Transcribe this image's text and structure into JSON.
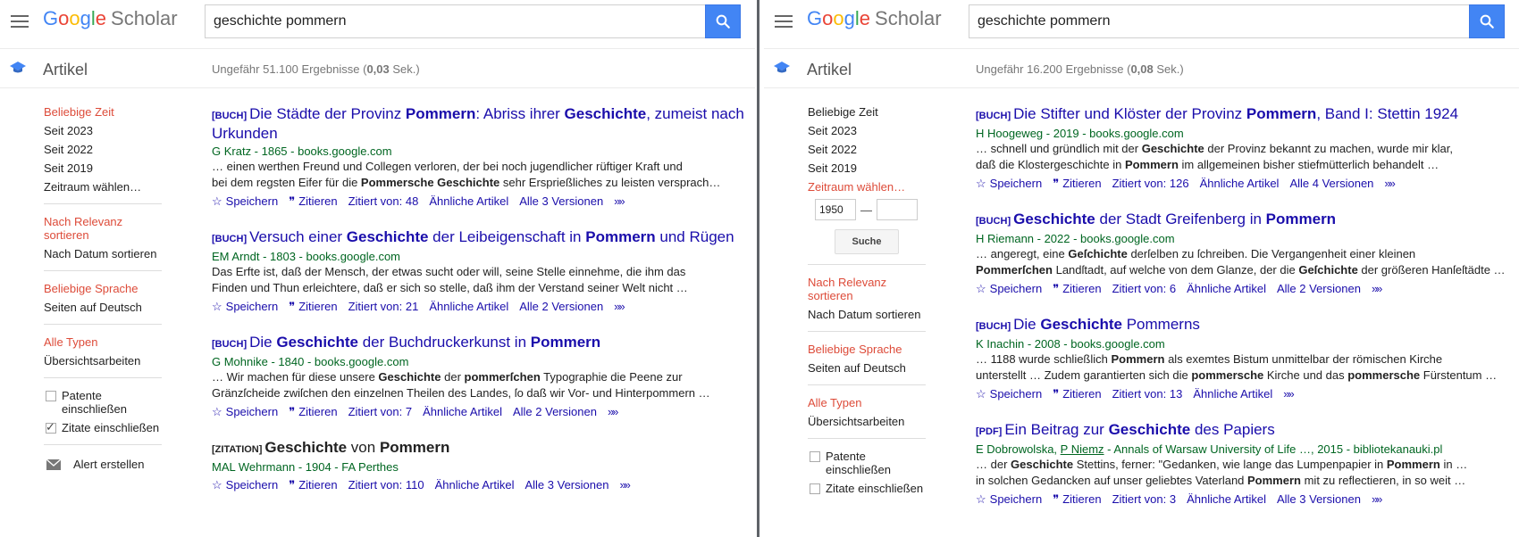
{
  "logo": {
    "google": [
      "G",
      "o",
      "o",
      "g",
      "l",
      "e"
    ],
    "scholar": "Scholar"
  },
  "section_title": "Artikel",
  "panels": [
    {
      "query": "geschichte pommern",
      "stats": {
        "prefix": "Ungefähr 51.100 Ergebnisse (",
        "time": "0,03",
        "suffix": " Sek.)"
      },
      "sidebar": {
        "time": [
          "Beliebige Zeit",
          "Seit 2023",
          "Seit 2022",
          "Seit 2019",
          "Zeitraum wählen…"
        ],
        "sort": [
          "Nach Relevanz sortieren",
          "Nach Datum sortieren"
        ],
        "lang": [
          "Beliebige Sprache",
          "Seiten auf Deutsch"
        ],
        "types": [
          "Alle Typen",
          "Übersichtsarbeiten"
        ],
        "checks": [
          {
            "label": "Patente einschließen",
            "checked": false
          },
          {
            "label": "Zitate einschließen",
            "checked": true
          }
        ],
        "alert": "Alert erstellen"
      },
      "results": [
        {
          "tag": "[BUCH]",
          "title": [
            [
              "Die Städte der Provinz ",
              false
            ],
            [
              "Pommern",
              true
            ],
            [
              ": Abriss ihrer ",
              false
            ],
            [
              "Geschichte",
              true
            ],
            [
              ", zumeist nach Urkunden",
              false
            ]
          ],
          "authors": [
            [
              "G Kratz - 1865 - books.google.com",
              false
            ]
          ],
          "snippet": [
            [
              [
                "… einen werthen Freund und Collegen verloren, der bei noch jugendlicher rüftiger Kraft und",
                false
              ]
            ],
            [
              [
                "bei dem regsten Eifer für die ",
                false
              ],
              [
                "Pommersche Geschichte",
                true
              ],
              [
                " sehr Ersprießliches zu leisten versprach…",
                false
              ]
            ]
          ],
          "links": {
            "save": "Speichern",
            "cite": "Zitieren",
            "cited": "Zitiert von: 48",
            "related": "Ähnliche Artikel",
            "versions": "Alle 3 Versionen"
          }
        },
        {
          "tag": "[BUCH]",
          "title": [
            [
              "Versuch einer ",
              false
            ],
            [
              "Geschichte",
              true
            ],
            [
              " der Leibeigenschaft in ",
              false
            ],
            [
              "Pommern",
              true
            ],
            [
              " und Rügen",
              false
            ]
          ],
          "authors": [
            [
              "EM Arndt - 1803 - books.google.com",
              false
            ]
          ],
          "snippet": [
            [
              [
                "Das Erfte ist, daß der Mensch, der etwas sucht oder will, seine Stelle einnehme, die ihm das",
                false
              ]
            ],
            [
              [
                "Finden und Thun erleichtere, daß er sich so stelle, daß ihm der Verstand seiner Welt nicht …",
                false
              ]
            ]
          ],
          "links": {
            "save": "Speichern",
            "cite": "Zitieren",
            "cited": "Zitiert von: 21",
            "related": "Ähnliche Artikel",
            "versions": "Alle 2 Versionen"
          }
        },
        {
          "tag": "[BUCH]",
          "title": [
            [
              "Die ",
              false
            ],
            [
              "Geschichte",
              true
            ],
            [
              " der Buchdruckerkunst in ",
              false
            ],
            [
              "Pommern",
              true
            ]
          ],
          "authors": [
            [
              "G Mohnike - 1840 - books.google.com",
              false
            ]
          ],
          "snippet": [
            [
              [
                "… Wir machen für diese unsere ",
                false
              ],
              [
                "Geschichte",
                true
              ],
              [
                " der ",
                false
              ],
              [
                "pommerſchen",
                true
              ],
              [
                " Typographie die Peene zur",
                false
              ]
            ],
            [
              [
                "Gränzſcheide zwiſchen den einzelnen Theilen des Landes, ſo daß wir Vor- und Hinterpommern …",
                false
              ]
            ]
          ],
          "links": {
            "save": "Speichern",
            "cite": "Zitieren",
            "cited": "Zitiert von: 7",
            "related": "Ähnliche Artikel",
            "versions": "Alle 2 Versionen"
          }
        },
        {
          "tag": "[ZITATION]",
          "plain": true,
          "title": [
            [
              "Geschichte",
              true
            ],
            [
              " von ",
              false
            ],
            [
              "Pommern",
              true
            ]
          ],
          "authors": [
            [
              "MAL Wehrmann - 1904 - FA Perthes",
              false
            ]
          ],
          "snippet": [],
          "links": {
            "save": "Speichern",
            "cite": "Zitieren",
            "cited": "Zitiert von: 110",
            "related": "Ähnliche Artikel",
            "versions": "Alle 3 Versionen"
          }
        }
      ]
    },
    {
      "query": "geschichte pommern",
      "stats": {
        "prefix": "Ungefähr 16.200 Ergebnisse (",
        "time": "0,08",
        "suffix": " Sek.)"
      },
      "sidebar": {
        "time": [
          "Beliebige Zeit",
          "Seit 2023",
          "Seit 2022",
          "Seit 2019",
          "Zeitraum wählen…"
        ],
        "range": {
          "from": "1950",
          "to": "",
          "button": "Suche"
        },
        "sort": [
          "Nach Relevanz sortieren",
          "Nach Datum sortieren"
        ],
        "lang": [
          "Beliebige Sprache",
          "Seiten auf Deutsch"
        ],
        "types": [
          "Alle Typen",
          "Übersichtsarbeiten"
        ],
        "checks": [
          {
            "label": "Patente einschließen",
            "checked": false
          },
          {
            "label": "Zitate einschließen",
            "checked": false
          }
        ]
      },
      "results": [
        {
          "tag": "[BUCH]",
          "title": [
            [
              "Die Stifter und Klöster der Provinz ",
              false
            ],
            [
              "Pommern",
              true
            ],
            [
              ", Band I: Stettin 1924",
              false
            ]
          ],
          "authors": [
            [
              "H Hoogeweg - 2019 - books.google.com",
              false
            ]
          ],
          "snippet": [
            [
              [
                "… schnell und gründlich mit der ",
                false
              ],
              [
                "Geschichte",
                true
              ],
              [
                " der Provinz bekannt zu machen, wurde mir klar,",
                false
              ]
            ],
            [
              [
                "daß die Klostergeschichte in ",
                false
              ],
              [
                "Pommern",
                true
              ],
              [
                " im allgemeinen bisher stiefmütterlich behandelt …",
                false
              ]
            ]
          ],
          "links": {
            "save": "Speichern",
            "cite": "Zitieren",
            "cited": "Zitiert von: 126",
            "related": "Ähnliche Artikel",
            "versions": "Alle 4 Versionen"
          }
        },
        {
          "tag": "[BUCH]",
          "title": [
            [
              "Geschichte",
              true
            ],
            [
              " der Stadt Greifenberg in ",
              false
            ],
            [
              "Pommern",
              true
            ]
          ],
          "authors": [
            [
              "H Riemann - 2022 - books.google.com",
              false
            ]
          ],
          "snippet": [
            [
              [
                "… angeregt, eine ",
                false
              ],
              [
                "Geſchichte",
                true
              ],
              [
                " derſelben zu ſchreiben. Die Vergangenheit einer kleinen",
                false
              ]
            ],
            [
              [
                "Pommerſchen",
                true
              ],
              [
                " Landſtadt, auf welche von dem Glanze, der die ",
                false
              ],
              [
                "Geſchichte",
                true
              ],
              [
                " der größeren Hanſeſtädte …",
                false
              ]
            ]
          ],
          "links": {
            "save": "Speichern",
            "cite": "Zitieren",
            "cited": "Zitiert von: 6",
            "related": "Ähnliche Artikel",
            "versions": "Alle 2 Versionen"
          }
        },
        {
          "tag": "[BUCH]",
          "title": [
            [
              "Die ",
              false
            ],
            [
              "Geschichte",
              true
            ],
            [
              " Pommerns",
              false
            ]
          ],
          "authors": [
            [
              "K Inachin - 2008 - books.google.com",
              false
            ]
          ],
          "snippet": [
            [
              [
                "… 1188 wurde schließlich ",
                false
              ],
              [
                "Pommern",
                true
              ],
              [
                " als exemtes Bistum unmittelbar der römischen Kirche",
                false
              ]
            ],
            [
              [
                "unterstellt … Zudem garantierten sich die ",
                false
              ],
              [
                "pommersche",
                true
              ],
              [
                " Kirche und das ",
                false
              ],
              [
                "pommersche",
                true
              ],
              [
                " Fürstentum …",
                false
              ]
            ]
          ],
          "links": {
            "save": "Speichern",
            "cite": "Zitieren",
            "cited": "Zitiert von: 13",
            "related": "Ähnliche Artikel"
          }
        },
        {
          "tag": "[PDF]",
          "title": [
            [
              "Ein Beitrag zur ",
              false
            ],
            [
              "Geschichte",
              true
            ],
            [
              " des Papiers",
              false
            ]
          ],
          "authors": [
            [
              "E Dobrowolska, ",
              false
            ],
            [
              "P Niemz",
              "u"
            ],
            [
              " - Annals of Warsaw University of Life …, 2015 - bibliotekanauki.pl",
              false
            ]
          ],
          "snippet": [
            [
              [
                "… der ",
                false
              ],
              [
                "Geschichte",
                true
              ],
              [
                " Stettins, ferner: \"Gedanken, wie lange das Lumpenpapier in ",
                false
              ],
              [
                "Pommern",
                true
              ],
              [
                " in …",
                false
              ]
            ],
            [
              [
                "in solchen Gedancken auf unser geliebtes Vaterland ",
                false
              ],
              [
                "Pommern",
                true
              ],
              [
                " mit zu reflectieren, in so weit …",
                false
              ]
            ]
          ],
          "links": {
            "save": "Speichern",
            "cite": "Zitieren",
            "cited": "Zitiert von: 3",
            "related": "Ähnliche Artikel",
            "versions": "Alle 3 Versionen"
          }
        }
      ]
    }
  ]
}
